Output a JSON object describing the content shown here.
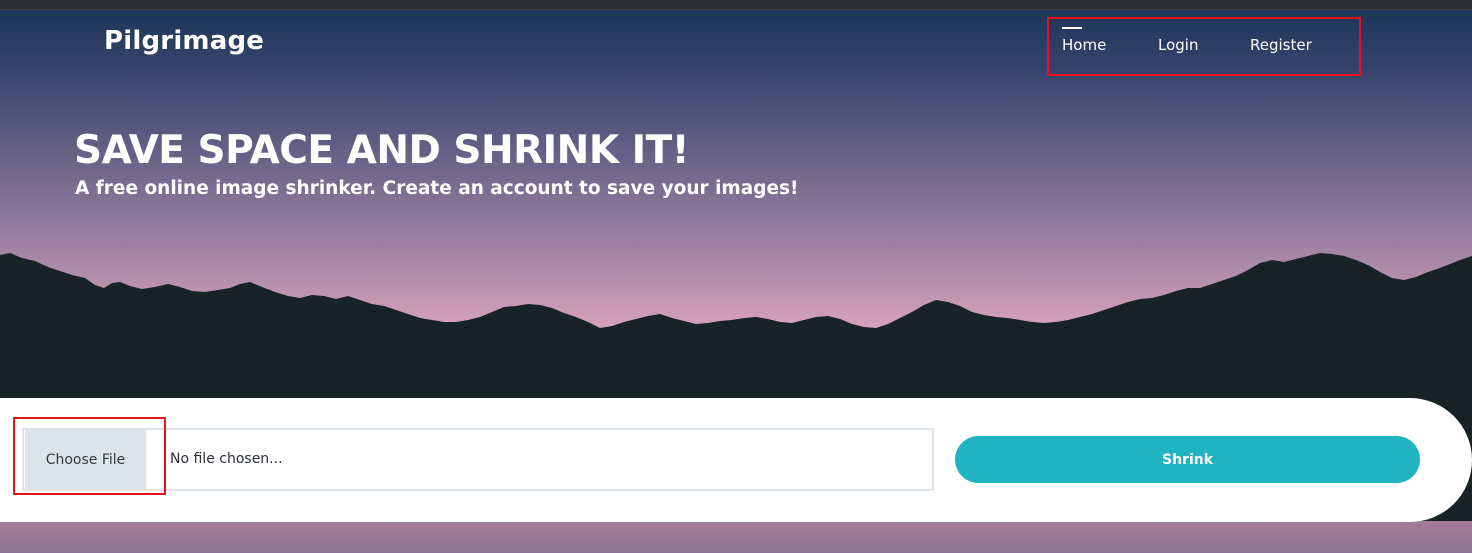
{
  "brand": {
    "name": "Pilgrimage"
  },
  "nav": {
    "items": [
      {
        "label": "Home",
        "active": true
      },
      {
        "label": "Login",
        "active": false
      },
      {
        "label": "Register",
        "active": false
      }
    ]
  },
  "hero": {
    "title": "SAVE SPACE AND SHRINK IT!",
    "subtitle": "A free online image shrinker. Create an account to save your images!"
  },
  "upload": {
    "choose_file_label": "Choose File",
    "file_status": "No file chosen...",
    "submit_label": "Shrink"
  },
  "colors": {
    "accent": "#22b3c1",
    "annotation": "#e8101a",
    "mountains": "#182326"
  }
}
